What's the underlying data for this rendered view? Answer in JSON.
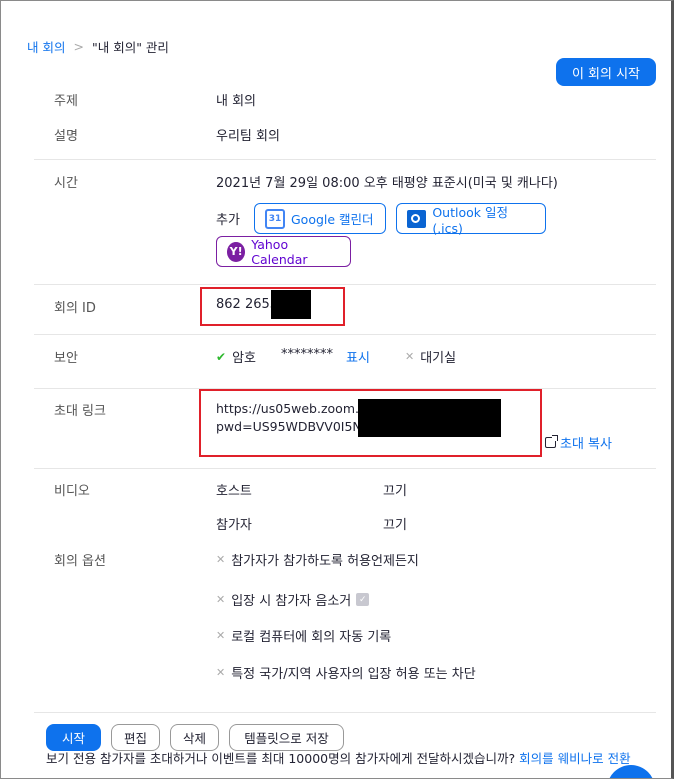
{
  "breadcrumb": {
    "root": "내 회의",
    "separator": ">",
    "current": "\"내 회의\" 관리"
  },
  "actions": {
    "start_meeting": "이 회의 시작"
  },
  "topic": {
    "label": "주제",
    "value": "내 회의"
  },
  "description": {
    "label": "설명",
    "value": "우리팀 회의"
  },
  "time": {
    "label": "시간",
    "value": "2021년 7월 29일 08:00 오후 태평양 표준시(미국 및 캐나다)",
    "add_label": "추가",
    "google": "Google 캘린더",
    "outlook": "Outlook 일정(.ics)",
    "yahoo": "Yahoo Calendar",
    "google_icon_text": "31"
  },
  "meeting_id": {
    "label": "회의 ID",
    "value": "862 2653"
  },
  "security": {
    "label": "보안",
    "passcode_label": "암호",
    "passcode_value": "********",
    "show": "표시",
    "waiting_room": "대기실"
  },
  "invite_link": {
    "label": "초대 링크",
    "line1": "https://us05web.zoom.us/",
    "line2": "pwd=US95WDBVV0I5Nj",
    "copy": "초대 복사"
  },
  "video": {
    "label": "비디오",
    "host_label": "호스트",
    "host_value": "끄기",
    "participant_label": "참가자",
    "participant_value": "끄기"
  },
  "options": {
    "label": "회의 옵션",
    "items": [
      "참가자가 참가하도록 허용언제든지",
      "입장 시 참가자 음소거",
      "로컬 컴퓨터에 회의 자동 기록",
      "특정 국가/지역 사용자의 입장 허용 또는 차단"
    ]
  },
  "bottom": {
    "start": "시작",
    "edit": "편집",
    "delete": "삭제",
    "save_template": "템플릿으로 저장",
    "footer_text": "보기 전용 참가자를 초대하거나 이벤트를 최대 10000명의 참가자에게 전달하시겠습니까? ",
    "footer_link": "회의를 웨비나로 전환"
  },
  "colors": {
    "accent": "#0e72ed",
    "redact": "#000000",
    "highlight": "#e0202a"
  }
}
